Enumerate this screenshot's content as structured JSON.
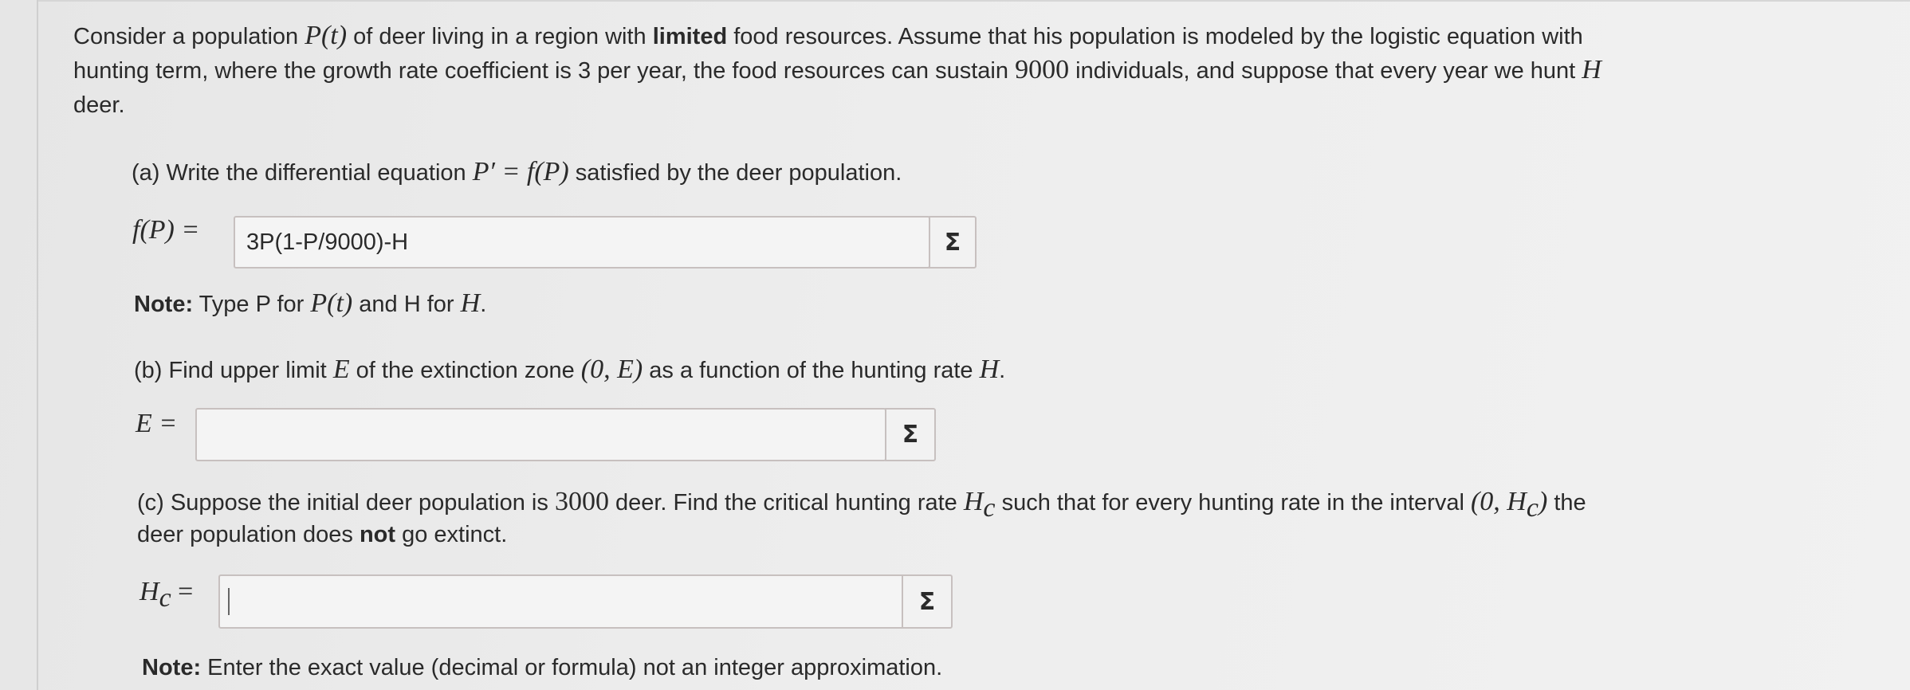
{
  "intro": {
    "line1_a": "Consider a population ",
    "line1_math": "P(t)",
    "line1_b": " of deer living in a region with ",
    "line1_bold": "limited",
    "line1_c": " food resources. Assume that his population is modeled by the logistic equation with",
    "line2_a": "hunting term, where the growth rate coefficient is 3 per year, the food resources can sustain ",
    "line2_num": "9000",
    "line2_b": " individuals, and suppose that every year we hunt ",
    "line2_math": "H",
    "line3": "deer."
  },
  "part_a": {
    "prompt_a": "(a) Write the differential equation ",
    "prompt_math": "P′ = f(P)",
    "prompt_b": " satisfied by the deer population.",
    "label": "f(P) =",
    "value": "3P(1-P/9000)-H",
    "note_bold": "Note:",
    "note_a": " Type P for ",
    "note_math1": "P(t)",
    "note_b": " and H for ",
    "note_math2": "H",
    "note_c": "."
  },
  "part_b": {
    "prompt_a": "(b) Find upper limit ",
    "prompt_math1": "E",
    "prompt_b": " of the extinction zone ",
    "prompt_math2": "(0, E)",
    "prompt_c": " as a function of the hunting rate ",
    "prompt_math3": "H",
    "prompt_d": ".",
    "label": "E =",
    "value": ""
  },
  "part_c": {
    "prompt_a": "(c) Suppose the initial deer population is ",
    "prompt_num": "3000",
    "prompt_b": " deer. Find the critical hunting rate ",
    "prompt_math1": "H",
    "prompt_sub1": "c",
    "prompt_c": " such that for every hunting rate in the interval ",
    "prompt_math2": "(0, H",
    "prompt_sub2": "c",
    "prompt_math2_end": ")",
    "prompt_d": " the",
    "line2_a": "deer population does ",
    "line2_bold": "not",
    "line2_b": " go extinct.",
    "label_math": "H",
    "label_sub": "c",
    "label_eq": " =",
    "value": "",
    "note_bold": "Note:",
    "note_text": " Enter the exact value (decimal or formula) not an integer approximation."
  },
  "sigma_symbol": "Σ",
  "icons": {
    "formula_editor": "sigma-icon"
  }
}
